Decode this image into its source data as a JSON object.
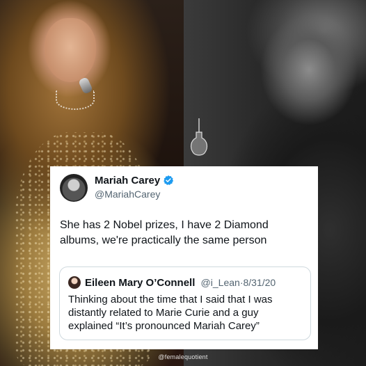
{
  "tweet": {
    "author_name": "Mariah Carey",
    "author_handle": "@MariahCarey",
    "verified_icon": "verified-badge-icon",
    "text": "She has 2 Nobel prizes, I have 2 Diamond albums, we're practically the same person",
    "accent_color": "#1d9bf0"
  },
  "quoted_tweet": {
    "author_name": "Eileen Mary O’Connell",
    "author_handle": "@i_Lean",
    "separator": "·",
    "date": "8/31/20",
    "text": "Thinking about the time that I said that I was distantly related to Marie Curie and a guy explained “It’s pronounced Mariah Carey”"
  },
  "watermark": "@femalequotient"
}
